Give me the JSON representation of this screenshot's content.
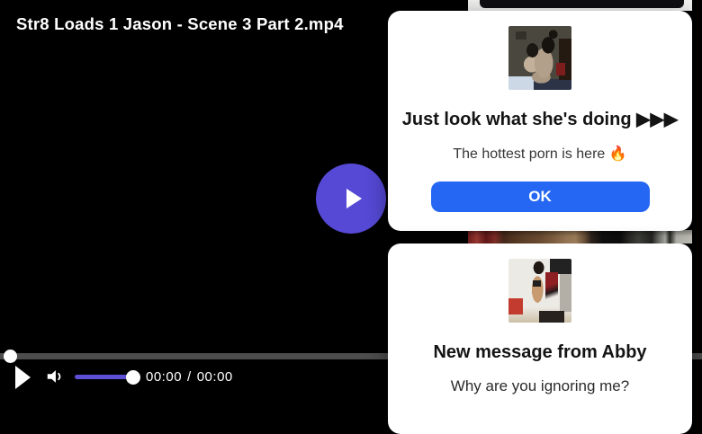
{
  "player": {
    "title": "Str8 Loads 1 Jason - Scene 3 Part 2.mp4",
    "current_time": "00:00",
    "time_separator": "/",
    "duration": "00:00",
    "accent_color": "#5549d6",
    "progress_track_color": "#4d4d4d",
    "icons": [
      "play-icon",
      "volume-low-icon"
    ]
  },
  "popups": [
    {
      "heading": "Just look what she's doing ▶▶▶",
      "message": "The hottest porn is here 🔥",
      "button_label": "OK",
      "button_color": "#2567f2",
      "thumbnail": "webcam-couple-thumbnail"
    },
    {
      "heading": "New message from Abby",
      "message": "Why are you ignoring me?",
      "thumbnail": "selfie-thumbnail"
    }
  ],
  "background_page": {
    "panel_color": "#f1f1f0",
    "thumbnail_strip": "video-thumbnail-strip"
  }
}
